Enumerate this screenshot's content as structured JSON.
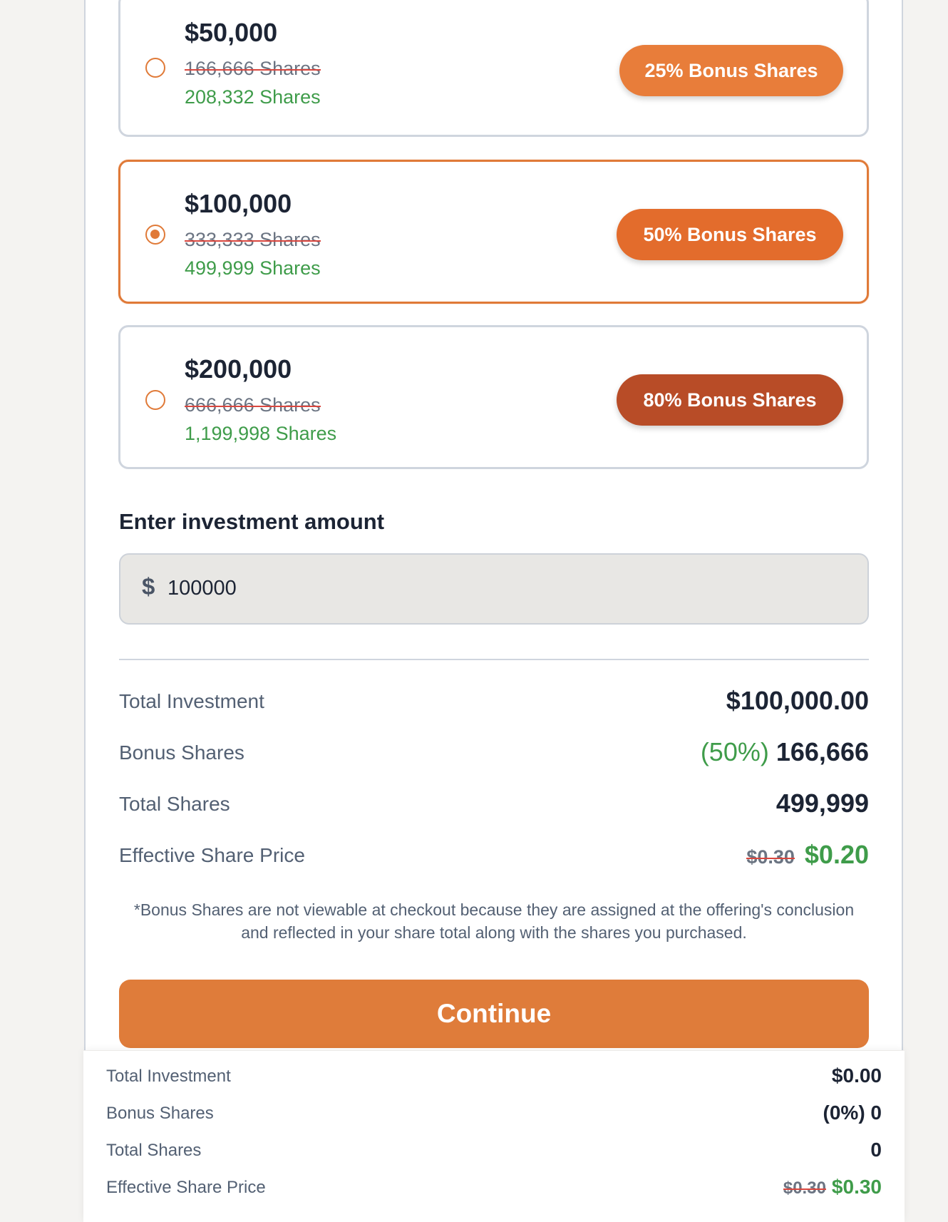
{
  "tiers": [
    {
      "amount": "$50,000",
      "original_shares": "166,666 Shares",
      "bonus_total_shares": "208,332 Shares",
      "badge": "25% Bonus Shares",
      "badge_color": "#e87d3a",
      "selected": false
    },
    {
      "amount": "$100,000",
      "original_shares": "333,333 Shares",
      "bonus_total_shares": "499,999 Shares",
      "badge": "50% Bonus Shares",
      "badge_color": "#e36c2c",
      "selected": true
    },
    {
      "amount": "$200,000",
      "original_shares": "666,666 Shares",
      "bonus_total_shares": "1,199,998 Shares",
      "badge": "80% Bonus Shares",
      "badge_color": "#b84c27",
      "selected": false
    }
  ],
  "investment": {
    "label": "Enter investment amount",
    "currency_symbol": "$",
    "value": "100000"
  },
  "summary": {
    "total_investment_label": "Total Investment",
    "total_investment_value": "$100,000.00",
    "bonus_shares_label": "Bonus Shares",
    "bonus_shares_percent": "(50%)",
    "bonus_shares_value": "166,666",
    "total_shares_label": "Total Shares",
    "total_shares_value": "499,999",
    "effective_price_label": "Effective Share Price",
    "effective_price_original": "$0.30",
    "effective_price_value": "$0.20"
  },
  "note": "*Bonus Shares are not viewable at checkout because they are assigned at the offering's conclusion and reflected in your share total along with the shares you purchased.",
  "continue_label": "Continue",
  "sticky_summary": {
    "total_investment_label": "Total Investment",
    "total_investment_value": "$0.00",
    "bonus_shares_label": "Bonus Shares",
    "bonus_shares_value": "(0%) 0",
    "total_shares_label": "Total Shares",
    "total_shares_value": "0",
    "effective_price_label": "Effective Share Price",
    "effective_price_original": "$0.30",
    "effective_price_value": "$0.30"
  },
  "colors": {
    "accent": "#df7c3a",
    "green": "#3f9c4a",
    "strike": "#d9463e"
  }
}
